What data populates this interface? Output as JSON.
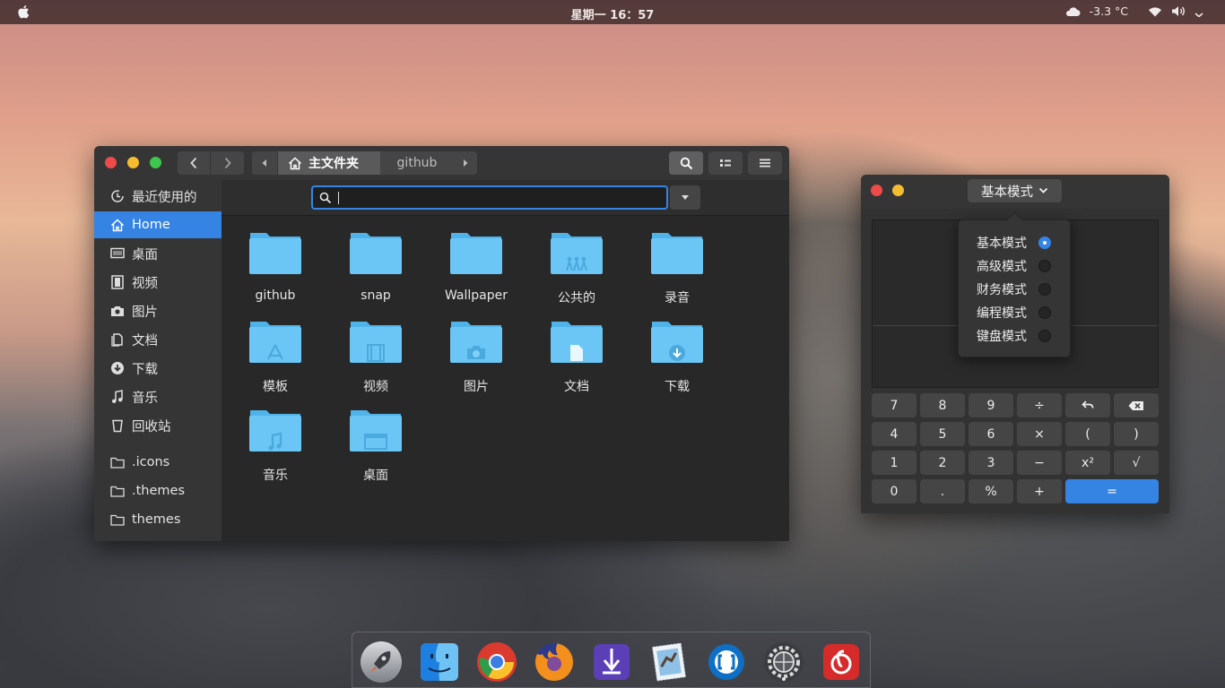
{
  "topbar": {
    "clock": "星期一 16：57",
    "temperature": "-3.3 °C"
  },
  "file_manager": {
    "breadcrumb": {
      "home_label": "主文件夹",
      "child_label": "github"
    },
    "sidebar": {
      "items": [
        {
          "label": "最近使用的",
          "icon": "recent-icon",
          "active": false
        },
        {
          "label": "Home",
          "icon": "home-icon",
          "active": true
        },
        {
          "label": "桌面",
          "icon": "desktop-icon",
          "active": false
        },
        {
          "label": "视频",
          "icon": "video-icon",
          "active": false
        },
        {
          "label": "图片",
          "icon": "camera-icon",
          "active": false
        },
        {
          "label": "文档",
          "icon": "document-icon",
          "active": false
        },
        {
          "label": "下载",
          "icon": "download-icon",
          "active": false
        },
        {
          "label": "音乐",
          "icon": "music-icon",
          "active": false
        },
        {
          "label": "回收站",
          "icon": "trash-icon",
          "active": false
        }
      ],
      "bookmarks": [
        {
          "label": ".icons",
          "icon": "folder-icon"
        },
        {
          "label": ".themes",
          "icon": "folder-icon"
        },
        {
          "label": "themes",
          "icon": "folder-icon"
        }
      ]
    },
    "search": {
      "value": "",
      "placeholder": ""
    },
    "folders": [
      {
        "label": "github",
        "emblem": "none"
      },
      {
        "label": "snap",
        "emblem": "none"
      },
      {
        "label": "Wallpaper",
        "emblem": "none"
      },
      {
        "label": "公共的",
        "emblem": "people"
      },
      {
        "label": "录音",
        "emblem": "none"
      },
      {
        "label": "模板",
        "emblem": "template"
      },
      {
        "label": "视频",
        "emblem": "film"
      },
      {
        "label": "图片",
        "emblem": "camera"
      },
      {
        "label": "文档",
        "emblem": "document"
      },
      {
        "label": "下载",
        "emblem": "download"
      },
      {
        "label": "音乐",
        "emblem": "music"
      },
      {
        "label": "桌面",
        "emblem": "desktop"
      }
    ]
  },
  "calculator": {
    "mode_label": "基本模式",
    "modes": [
      {
        "label": "基本模式",
        "selected": true
      },
      {
        "label": "高级模式",
        "selected": false
      },
      {
        "label": "财务模式",
        "selected": false
      },
      {
        "label": "编程模式",
        "selected": false
      },
      {
        "label": "键盘模式",
        "selected": false
      }
    ],
    "keys": [
      [
        "7",
        "8",
        "9",
        "÷",
        "undo-icon",
        "backspace-icon"
      ],
      [
        "4",
        "5",
        "6",
        "×",
        "(",
        ")"
      ],
      [
        "1",
        "2",
        "3",
        "−",
        "x²",
        "√"
      ],
      [
        "0",
        ".",
        "%",
        "+",
        "="
      ]
    ]
  },
  "dock": {
    "apps": [
      "launchpad-rocket-icon",
      "finder-icon",
      "chrome-icon",
      "firefox-icon",
      "app-store-icon",
      "mail-stamp-icon",
      "teamviewer-icon",
      "system-settings-icon",
      "netease-music-icon"
    ]
  },
  "colors": {
    "accent": "#3584e4",
    "folder": "#6cc6f5",
    "close": "#ed4a4a",
    "minimize": "#f5bc2f",
    "maximize": "#3fc64c"
  }
}
